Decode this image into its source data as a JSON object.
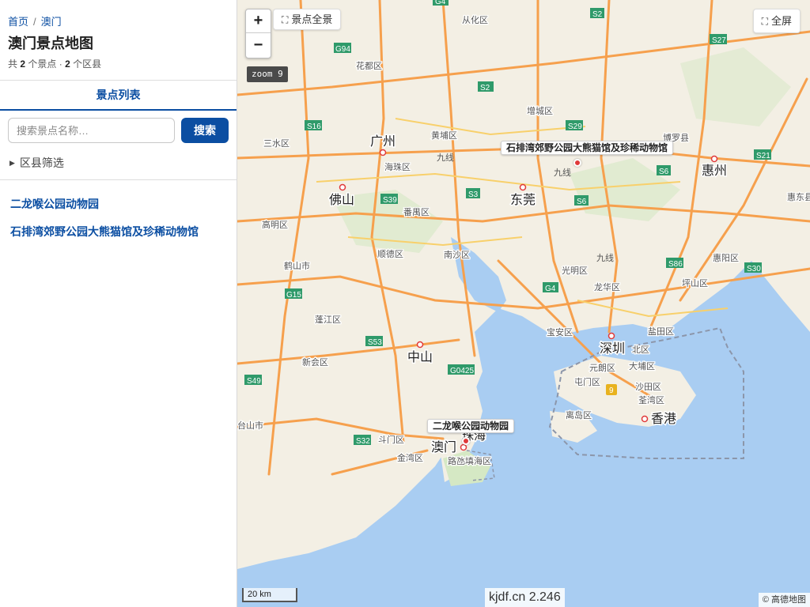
{
  "sidebar": {
    "breadcrumb": {
      "home": "首页",
      "separator": "/",
      "current": "澳门"
    },
    "title": "澳门景点地图",
    "stats": {
      "prefix": "共",
      "poi_count": "2",
      "poi_unit": "个景点 ·",
      "district_count": "2",
      "district_unit": "个区县"
    },
    "tab_label": "景点列表",
    "search": {
      "placeholder": "搜索景点名称…",
      "button_label": "搜索"
    },
    "filter_label": "区县筛选",
    "pois": [
      {
        "name": "二龙喉公园动物园"
      },
      {
        "name": "石排湾郊野公园大熊猫馆及珍稀动物馆"
      }
    ]
  },
  "map": {
    "zoom_in_label": "+",
    "zoom_out_label": "−",
    "fit_all_label": "景点全景",
    "fullscreen_label": "全屏",
    "zoom_level": "zoom 9",
    "scale_label": "20 km",
    "watermark": "kjdf.cn 2.246",
    "attribution": "© 高德地图",
    "marker_labels": [
      "石排湾郊野公园大熊猫馆及珍稀动物馆",
      "二龙喉公园动物园"
    ],
    "cities": [
      "广州",
      "佛山",
      "东莞",
      "惠州",
      "中山",
      "深圳",
      "香港",
      "澳门",
      "珠海"
    ],
    "districts": [
      "从化区",
      "花都区",
      "增城区",
      "黄埔区",
      "博罗县",
      "三水区",
      "海珠区",
      "番禺区",
      "高明区",
      "顺德区",
      "南沙区",
      "惠阳区",
      "鹤山市",
      "光明区",
      "龙华区",
      "坪山区",
      "惠东县",
      "蓬江区",
      "宝安区",
      "盐田区",
      "新会区",
      "元朗区",
      "大埔区",
      "屯门区",
      "沙田区",
      "北区",
      "荃湾区",
      "离岛区",
      "斗门区",
      "金湾区",
      "路氹填海区",
      "台山市"
    ],
    "road_shields": [
      "G4",
      "S2",
      "S27",
      "G94",
      "S2",
      "S16",
      "S29",
      "S3",
      "S6",
      "S6",
      "S21",
      "S39",
      "S86",
      "S30",
      "G15",
      "G4",
      "S53",
      "G0425",
      "S49",
      "S32",
      "9"
    ],
    "rail_labels": [
      "九线",
      "九线",
      "九线"
    ],
    "colors": {
      "land": "#f3efe4",
      "water": "#a9cdf2",
      "highway": "#f6a04d",
      "primary_road": "#f8d06b",
      "park": "#d5e8c4",
      "shield": "#2f9a6a",
      "accent": "#0b4ea2"
    }
  }
}
